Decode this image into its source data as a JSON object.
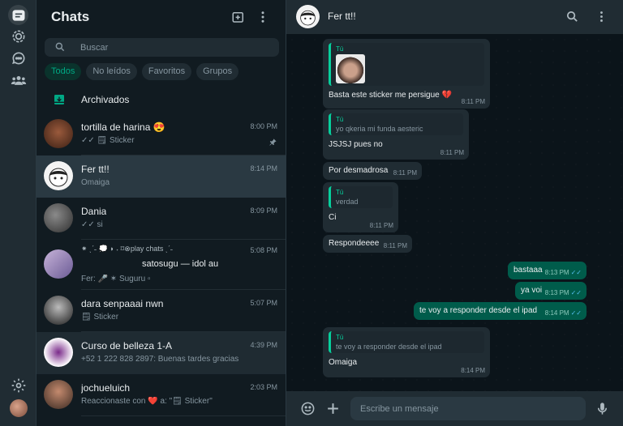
{
  "sidebar_list": {
    "title": "Chats",
    "search_placeholder": "Buscar",
    "filters": [
      "Todos",
      "No leídos",
      "Favoritos",
      "Grupos"
    ],
    "archived_label": "Archivados",
    "chats": [
      {
        "name": "tortilla de harina 😍",
        "time": "8:00 PM",
        "preview": "✓✓ 🗒 Sticker",
        "pinned": true
      },
      {
        "name": "Fer tt!!",
        "time": "8:14 PM",
        "preview": "Omaiga",
        "selected": true
      },
      {
        "name": "Dania",
        "time": "8:09 PM",
        "preview": "✓✓ si"
      },
      {
        "name": "satosugu — idol au",
        "time": "5:08 PM",
        "preview": "Fer: 🎤   ✶   Suguru   ▫",
        "decor": "⁕ ˎˊ˗ 💭 ◗ ˖ ⌑⊗play chats ˎˊ˗"
      },
      {
        "name": "dara senpaaai nwn",
        "time": "5:07 PM",
        "preview": "🗒 Sticker"
      },
      {
        "name": "Curso de belleza 1-A",
        "time": "4:39 PM",
        "preview": "+52 1 222 828 2897: Buenas tardes gracias"
      },
      {
        "name": "jochueluich",
        "time": "2:03 PM",
        "preview": "Reaccionaste con ❤️ a: \"🗒 Sticker\""
      }
    ]
  },
  "conversation": {
    "contact_name": "Fer tt!!",
    "composer_placeholder": "Escribe un mensaje",
    "messages": [
      {
        "dir": "in",
        "quote_who": "Tú",
        "quote_text": "",
        "text": "Basta este sticker me persigue 💔",
        "time": "8:11 PM"
      },
      {
        "dir": "in",
        "quote_who": "Tú",
        "quote_text": "yo qkeria mi funda aesteric",
        "text": "JSJSJ pues no",
        "time": "8:11 PM"
      },
      {
        "dir": "in",
        "text": "Por desmadrosa",
        "time": "8:11 PM"
      },
      {
        "dir": "in",
        "quote_who": "Tú",
        "quote_text": "verdad",
        "text": "Ci",
        "time": "8:11 PM"
      },
      {
        "dir": "in",
        "text": "Respondeeee",
        "time": "8:11 PM"
      },
      {
        "dir": "out",
        "text": "bastaaa",
        "time": "8:13 PM"
      },
      {
        "dir": "out",
        "text": "ya voi",
        "time": "8:13 PM"
      },
      {
        "dir": "out",
        "text": "te voy a responder desde el ipad",
        "time": "8:14 PM"
      },
      {
        "dir": "in",
        "quote_who": "Tú",
        "quote_text": "te voy a responder desde el ipad",
        "text": "Omaiga",
        "time": "8:14 PM"
      }
    ]
  },
  "icons": {
    "rail": [
      "chats-icon",
      "status-icon",
      "channels-icon",
      "communities-icon",
      "settings-icon"
    ],
    "list_header": [
      "new-chat-icon",
      "menu-icon"
    ],
    "convo_header": [
      "search-icon",
      "menu-icon"
    ],
    "composer": [
      "emoji-icon",
      "attach-icon",
      "mic-icon"
    ]
  },
  "colors": {
    "accent": "#00a884",
    "outgoing_bubble": "#005c4b",
    "incoming_bubble": "#202c33",
    "read_ticks": "#53bdeb"
  }
}
